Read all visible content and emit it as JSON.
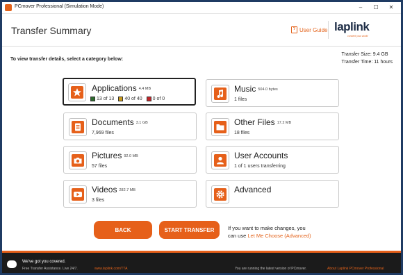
{
  "window": {
    "title": "PCmover Professional (Simulation Mode)",
    "controls": [
      "–",
      "☐",
      "✕"
    ]
  },
  "header": {
    "title": "Transfer Summary",
    "user_guide": "User Guide",
    "logo": "laplink",
    "logo_tagline": "connect your world"
  },
  "instruction": "To view transfer details, select a category below:",
  "stats": {
    "size": "Transfer Size: 9.4 GB",
    "time": "Transfer Time: 11 hours"
  },
  "categories": [
    {
      "title": "Applications",
      "size": "4.4 MB",
      "counts": [
        "13 of 13",
        "40 of 40",
        "0 of 0"
      ],
      "count_colors": [
        "#2e6b2e",
        "#c99a1c",
        "#c0262a"
      ],
      "icon": "star-icon",
      "selected": true
    },
    {
      "title": "Music",
      "size": "504.0 bytes",
      "sub": "1 files",
      "icon": "music-note-icon"
    },
    {
      "title": "Documents",
      "size": "3.1 GB",
      "sub": "7,969 files",
      "icon": "document-icon"
    },
    {
      "title": "Other Files",
      "size": "17.2 MB",
      "sub": "18 files",
      "icon": "folder-icon"
    },
    {
      "title": "Pictures",
      "size": "92.0 MB",
      "sub": "57 files",
      "icon": "camera-icon"
    },
    {
      "title": "User Accounts",
      "size": "",
      "sub": "1 of 1 users transferring",
      "icon": "user-icon"
    },
    {
      "title": "Videos",
      "size": "282.7 MB",
      "sub": "3 files",
      "icon": "play-icon"
    },
    {
      "title": "Advanced",
      "size": "",
      "sub": "",
      "icon": "gear-icon"
    }
  ],
  "buttons": {
    "back": "BACK",
    "start": "START TRANSFER"
  },
  "changes": {
    "line1": "If you want to make changes, you",
    "prefix": "can use ",
    "link": "Let Me Choose (Advanced)"
  },
  "footer": {
    "heading": "We've got you covered.",
    "sub": "Free Transfer Assistance. Live 24/7.",
    "url": "www.laplink.com/TTA",
    "version": "You are running the latest version of PCmover.",
    "about": "About Laplink PCmover Professional"
  },
  "colors": {
    "accent": "#e6601a",
    "footer": "#1b1b1b"
  }
}
